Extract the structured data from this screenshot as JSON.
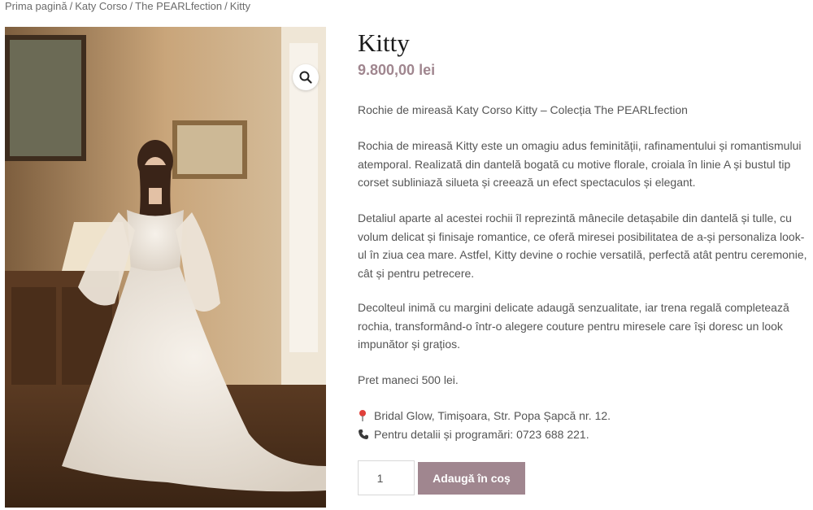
{
  "breadcrumb": {
    "items": [
      "Prima pagină",
      "Katy Corso",
      "The PEARLfection",
      "Kitty"
    ],
    "separator": "/"
  },
  "product": {
    "title": "Kitty",
    "price": "9.800,00 lei",
    "image_alt_icon": "zoom-icon"
  },
  "description": {
    "intro": "Rochie de mireasă Katy Corso Kitty – Colecția The PEARLfection",
    "p1": "Rochia de mireasă Kitty este un omagiu adus feminității, rafinamentului și romantismului atemporal. Realizată din dantelă bogată cu motive florale, croiala în linie A și bustul tip corset subliniază silueta și creează un efect spectaculos și elegant.",
    "p2": "Detaliul aparte al acestei rochii îl reprezintă mânecile detașabile din dantelă și tulle, cu volum delicat și finisaje romantice, ce oferă miresei posibilitatea de a-și personaliza look-ul în ziua cea mare. Astfel, Kitty devine o rochie versatilă, perfectă atât pentru ceremonie, cât și pentru petrecere.",
    "p3": "Decolteul inimă cu margini delicate adaugă senzualitate, iar trena regală completează rochia, transformând-o într-o alegere couture pentru miresele care își doresc un look impunător și grațios.",
    "p4": "Pret maneci 500 lei."
  },
  "contact": {
    "address_icon": "pin-icon",
    "address": "Bridal Glow, Timișoara, Str. Popa Șapcă nr. 12.",
    "phone_icon": "phone-icon",
    "phone": "Pentru detalii și programări: 0723 688 221."
  },
  "cart": {
    "quantity": "1",
    "add_label": "Adaugă în coș"
  },
  "colors": {
    "accent": "#a0868f",
    "title": "#1a1a1a",
    "body_text": "#555555"
  }
}
